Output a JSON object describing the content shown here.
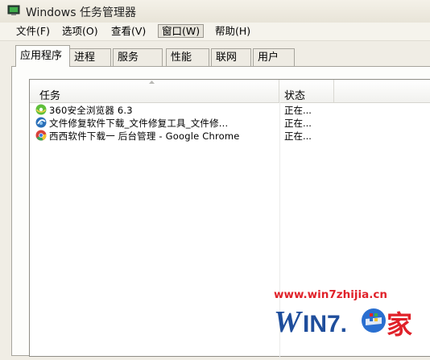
{
  "window": {
    "title": "Windows 任务管理器"
  },
  "menu": [
    {
      "label": "文件(F)"
    },
    {
      "label": "选项(O)"
    },
    {
      "label": "查看(V)"
    },
    {
      "label": "窗口(W)"
    },
    {
      "label": "帮助(H)"
    }
  ],
  "tabs": [
    {
      "label": "应用程序",
      "selected": true
    },
    {
      "label": "进程"
    },
    {
      "label": "服务"
    },
    {
      "label": "性能"
    },
    {
      "label": "联网"
    },
    {
      "label": "用户"
    }
  ],
  "list": {
    "columns": {
      "task": "任务",
      "status": "状态"
    },
    "rows": [
      {
        "name": "360安全浏览器 6.3",
        "status": "正在...",
        "icon": "browser-360-icon"
      },
      {
        "name": "文件修复软件下载_文件修复工具_文件修...",
        "status": "正在...",
        "icon": "browser-page-icon"
      },
      {
        "name": "西西软件下载一 后台管理 - Google Chrome",
        "status": "正在...",
        "icon": "chrome-icon"
      }
    ]
  },
  "watermark": {
    "url": "www.win7zhijia.cn",
    "logo_text": "WIN7.家"
  },
  "colors": {
    "watermark_red": "#e0222a",
    "watermark_blue": "#1f4e9c"
  }
}
